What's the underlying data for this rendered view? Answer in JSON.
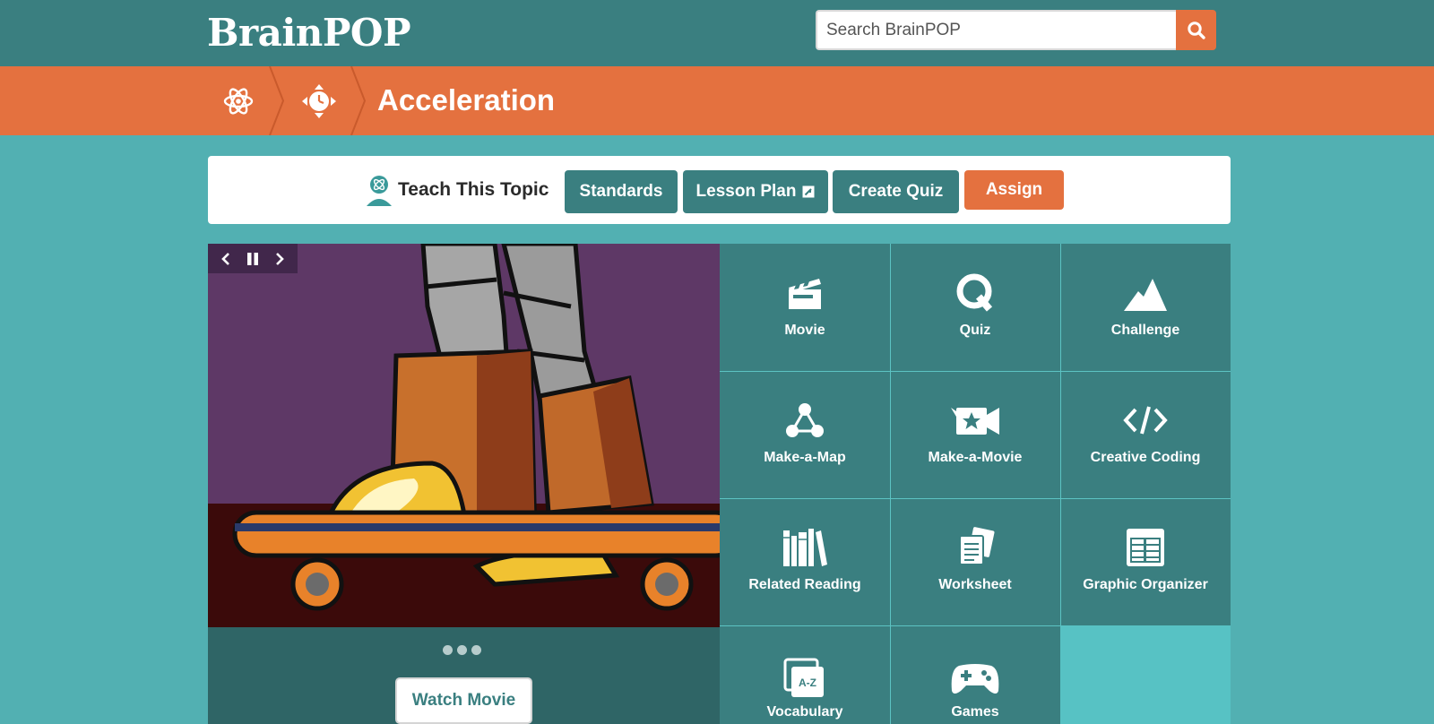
{
  "header": {
    "logo": "BrainPOP",
    "search": {
      "placeholder": "Search BrainPOP",
      "value": ""
    }
  },
  "breadcrumb": {
    "items": [
      {
        "icon": "atom-icon"
      },
      {
        "icon": "motion-clock-icon"
      }
    ],
    "title": "Acceleration"
  },
  "teach": {
    "label": "Teach This Topic",
    "buttons": {
      "standards": "Standards",
      "lesson_plan": "Lesson Plan",
      "create_quiz": "Create Quiz",
      "assign": "Assign"
    }
  },
  "slideshow": {
    "slide_count": 3,
    "watch_label": "Watch Movie"
  },
  "tiles": [
    {
      "label": "Movie",
      "icon": "clapperboard-icon"
    },
    {
      "label": "Quiz",
      "icon": "quiz-q-icon"
    },
    {
      "label": "Challenge",
      "icon": "mountain-icon"
    },
    {
      "label": "Make-a-Map",
      "icon": "concept-map-icon"
    },
    {
      "label": "Make-a-Movie",
      "icon": "star-camera-icon"
    },
    {
      "label": "Creative Coding",
      "icon": "code-icon"
    },
    {
      "label": "Related Reading",
      "icon": "books-icon"
    },
    {
      "label": "Worksheet",
      "icon": "worksheet-icon"
    },
    {
      "label": "Graphic Organizer",
      "icon": "table-icon"
    },
    {
      "label": "Vocabulary",
      "icon": "az-cards-icon"
    },
    {
      "label": "Games",
      "icon": "gamepad-icon"
    }
  ],
  "colors": {
    "header": "#3a7f80",
    "accent": "#e4713f",
    "page": "#52b0b2",
    "tile": "#3a7f80"
  }
}
